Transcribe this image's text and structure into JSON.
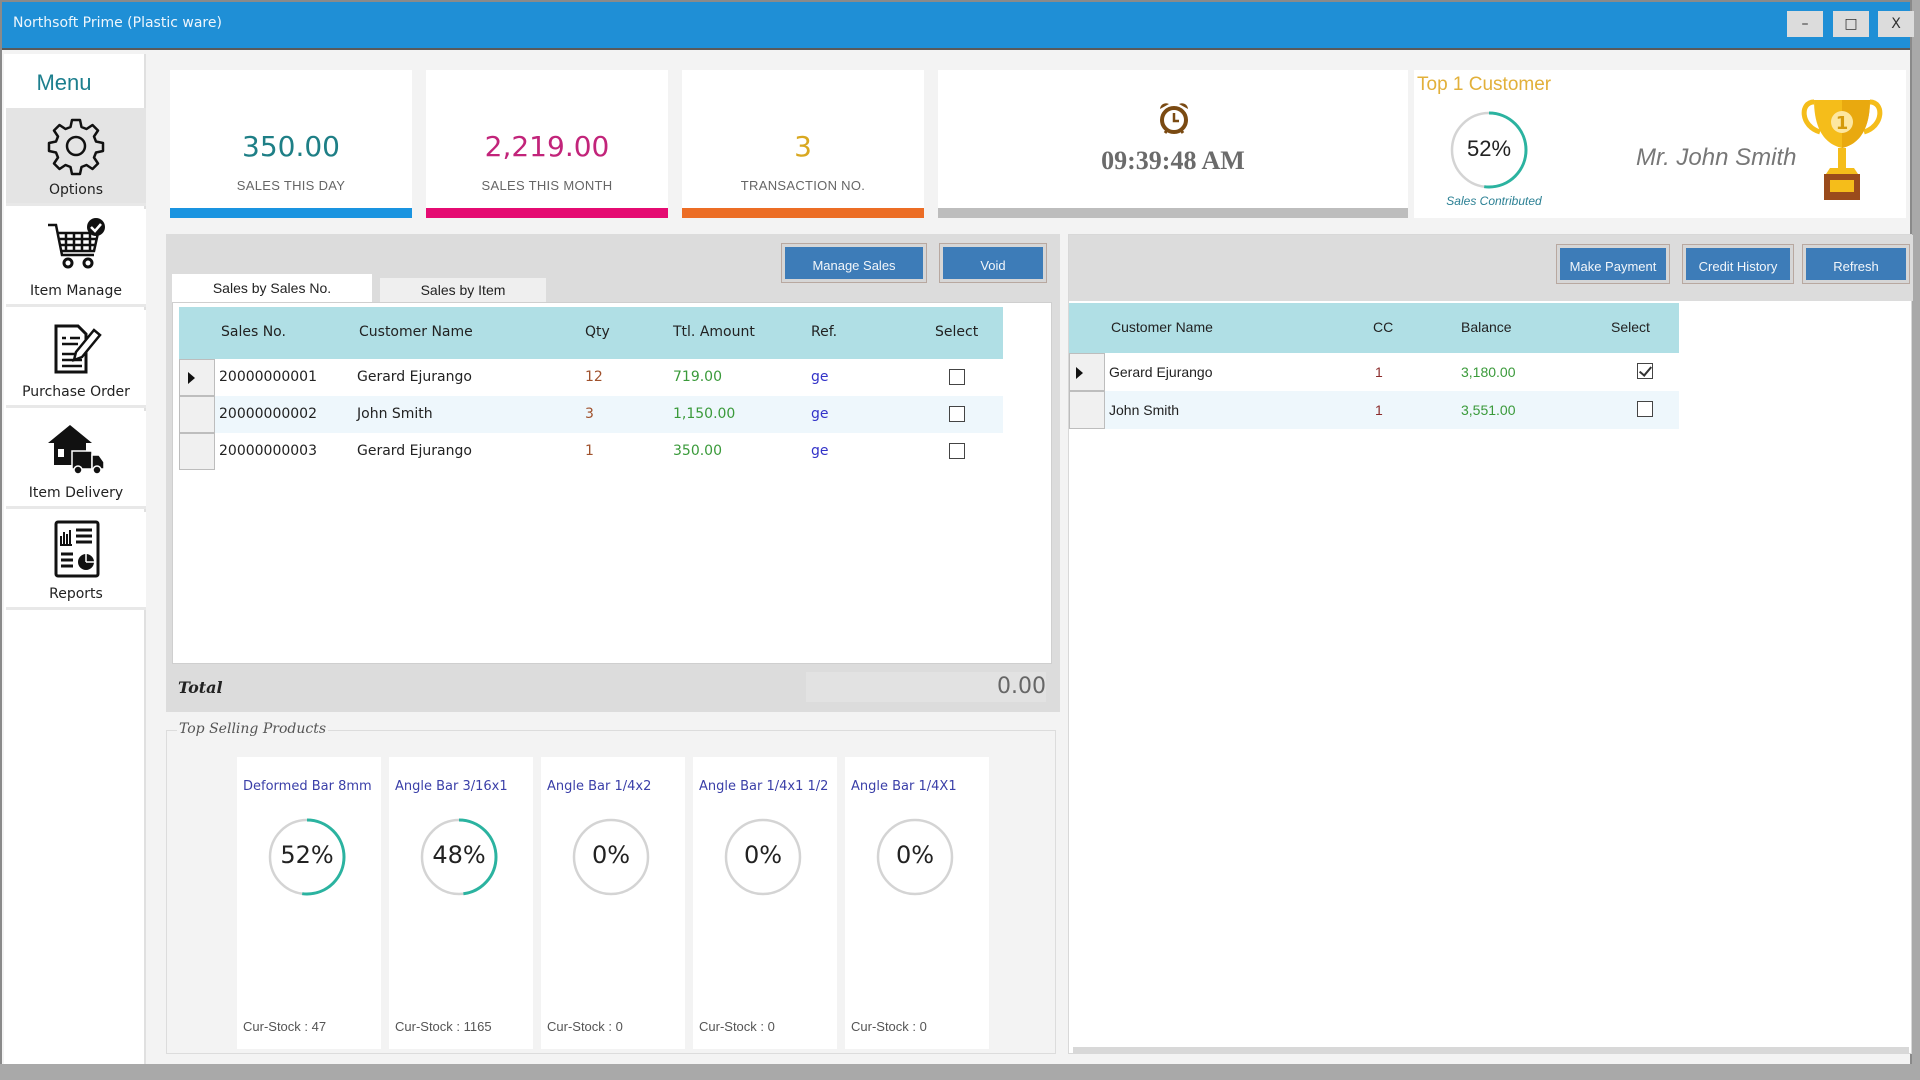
{
  "window": {
    "title": "Northsoft Prime (Plastic ware)",
    "controls": {
      "minimize": "–",
      "maximize": "□",
      "close": "X"
    }
  },
  "sidebar": {
    "title": "Menu",
    "items": [
      {
        "label": "Options",
        "icon": "gear-icon",
        "active": true
      },
      {
        "label": "Item Manage",
        "icon": "cart-check-icon",
        "active": false
      },
      {
        "label": "Purchase Order",
        "icon": "document-edit-icon",
        "active": false
      },
      {
        "label": "Item Delivery",
        "icon": "house-truck-icon",
        "active": false
      },
      {
        "label": "Reports",
        "icon": "report-chart-icon",
        "active": false
      }
    ]
  },
  "stats": {
    "sales_day": {
      "value": "350.00",
      "caption": "SALES THIS DAY",
      "color": "#1e7f86",
      "bar_color": "#1a94e0"
    },
    "sales_month": {
      "value": "2,219.00",
      "caption": "SALES THIS MONTH",
      "color": "#c2247a",
      "bar_color": "#e50b72"
    },
    "transactions": {
      "value": "3",
      "caption": "TRANSACTION NO.",
      "color": "#d9a820",
      "bar_color": "#ec6d25"
    }
  },
  "clock": {
    "time": "09:39:48 AM",
    "icon": "alarm-clock-icon"
  },
  "top_customer": {
    "heading": "Top 1 Customer",
    "percent_label": "52%",
    "percent": 52,
    "subtitle": "Sales Contributed",
    "name": "Mr. John Smith",
    "icon": "trophy-icon"
  },
  "sales_panel": {
    "buttons": {
      "manage_sales": "Manage Sales",
      "void": "Void"
    },
    "tabs": [
      {
        "label": "Sales by Sales No.",
        "active": true
      },
      {
        "label": "Sales by Item",
        "active": false
      }
    ],
    "columns": [
      "Sales No.",
      "Customer Name",
      "Qty",
      "Ttl. Amount",
      "Ref.",
      "Select"
    ],
    "rows": [
      {
        "sales_no": "20000000001",
        "customer": "Gerard Ejurango",
        "qty": "12",
        "amount": "719.00",
        "ref": "ge",
        "selected": false,
        "current": true
      },
      {
        "sales_no": "20000000002",
        "customer": "John Smith",
        "qty": "3",
        "amount": "1,150.00",
        "ref": "ge",
        "selected": false,
        "current": false
      },
      {
        "sales_no": "20000000003",
        "customer": "Gerard Ejurango",
        "qty": "1",
        "amount": "350.00",
        "ref": "ge",
        "selected": false,
        "current": false
      }
    ],
    "total_label": "Total",
    "total_value": "0.00"
  },
  "top_selling": {
    "legend": "Top Selling Products",
    "products": [
      {
        "name": "Deformed Bar 8mm",
        "percent_label": "52%",
        "percent": 52,
        "stock": "Cur-Stock : 47"
      },
      {
        "name": "Angle Bar 3/16x1",
        "percent_label": "48%",
        "percent": 48,
        "stock": "Cur-Stock : 1165"
      },
      {
        "name": "Angle Bar 1/4x2",
        "percent_label": "0%",
        "percent": 0,
        "stock": "Cur-Stock : 0"
      },
      {
        "name": "Angle Bar 1/4x1 1/2",
        "percent_label": "0%",
        "percent": 0,
        "stock": "Cur-Stock : 0"
      },
      {
        "name": "Angle Bar 1/4X1",
        "percent_label": "0%",
        "percent": 0,
        "stock": "Cur-Stock : 0"
      }
    ]
  },
  "credit_panel": {
    "buttons": {
      "make_payment": "Make Payment",
      "credit_history": "Credit History",
      "refresh": "Refresh"
    },
    "columns": [
      "Customer Name",
      "CC",
      "Balance",
      "Select"
    ],
    "rows": [
      {
        "customer": "Gerard Ejurango",
        "cc": "1",
        "balance": "3,180.00",
        "selected": true,
        "current": true
      },
      {
        "customer": "John Smith",
        "cc": "1",
        "balance": "3,551.00",
        "selected": false,
        "current": false
      }
    ]
  },
  "colors": {
    "titlebar": "#1f8fd6",
    "grid_header": "#b0dfe5",
    "button": "#3d7cb8",
    "ring_progress": "#2bb3a0",
    "qty_text": "#a0522d",
    "amount_text": "#3a9a3a",
    "ref_text": "#3232c8"
  }
}
